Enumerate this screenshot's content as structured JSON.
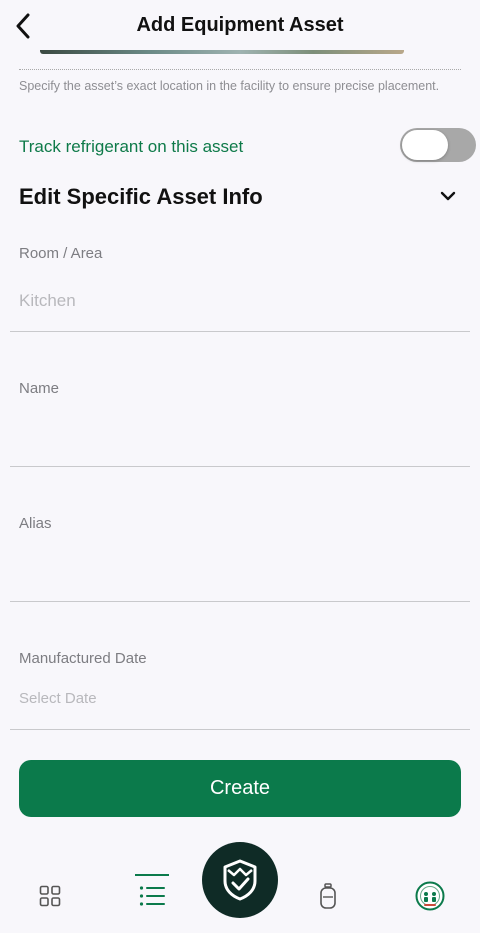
{
  "header": {
    "title": "Add Equipment Asset"
  },
  "location": {
    "helper_text": "Specify the asset’s exact location in the facility to ensure precise placement."
  },
  "refrigerant": {
    "label": "Track refrigerant on this asset",
    "enabled": false
  },
  "section": {
    "title": "Edit Specific Asset Info"
  },
  "fields": {
    "room": {
      "label": "Room / Area",
      "placeholder": "Kitchen",
      "value": ""
    },
    "name": {
      "label": "Name",
      "value": ""
    },
    "alias": {
      "label": "Alias",
      "value": ""
    },
    "manufactured_date": {
      "label": "Manufactured Date",
      "placeholder": "Select Date"
    }
  },
  "actions": {
    "create_label": "Create"
  },
  "tabbar": {
    "active": "list",
    "items": [
      "grid-icon",
      "list-icon",
      "shield-check-icon",
      "refrigerant-cylinder-icon",
      "hvac-badge-icon"
    ]
  },
  "colors": {
    "accent": "#0b7a4b",
    "accent_text": "#0e7a49",
    "center_button": "#0f2b26",
    "toggle_off": "#a8a8a8",
    "background": "#f8f7fb"
  }
}
